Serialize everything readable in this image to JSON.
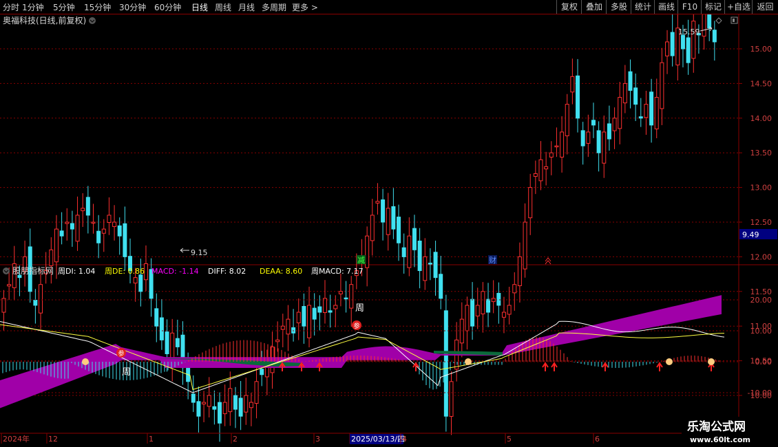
{
  "toolbar": {
    "periods": [
      "分时",
      "1分钟",
      "5分钟",
      "15分钟",
      "30分钟",
      "60分钟",
      "日线",
      "周线",
      "月线",
      "多周期",
      "更多"
    ],
    "active": "日线",
    "more_arrow": ">",
    "actions": [
      "复权",
      "叠加",
      "多股",
      "统计",
      "画线",
      "F10",
      "标记",
      "+自选",
      "返回"
    ]
  },
  "price_panel": {
    "title": "奥福科技(日线,前复权)",
    "y_ticks": [
      "15.00",
      "14.50",
      "14.00",
      "13.50",
      "13.00",
      "12.50",
      "12.00",
      "11.50",
      "11.00",
      "10.50",
      "10.00"
    ],
    "current_price": "9.49",
    "low_marker": "9.15",
    "high_marker": "15.59",
    "markers": [
      {
        "text": "减",
        "color": "#00c000"
      },
      {
        "text": "财",
        "color": "#3060ff"
      }
    ]
  },
  "indicator_panel": {
    "title": "股朋指标网",
    "values": [
      {
        "label": "周DI:",
        "value": "1.04",
        "color": "#ffffff"
      },
      {
        "label": "周DE:",
        "value": "0.86",
        "color": "#ffff00"
      },
      {
        "label": "MACD:",
        "value": "-1.14",
        "color": "#ff00ff"
      },
      {
        "label": "DIFF:",
        "value": "8.02",
        "color": "#ffffff"
      },
      {
        "label": "DEAA:",
        "value": "8.60",
        "color": "#ffff00"
      },
      {
        "label": "周MACD:",
        "value": "7.17",
        "color": "#ffffff"
      }
    ],
    "y_ticks": [
      "20.00",
      "10.00",
      "0.00",
      "-10.00"
    ],
    "week_label": "周",
    "week_label2": "周",
    "badge": "参"
  },
  "date_axis": {
    "labels": [
      "2024年",
      "12",
      "1",
      "2",
      "3",
      "2025/03/13/四",
      "4",
      "5",
      "6"
    ]
  },
  "watermark": {
    "name": "乐淘公式网",
    "url": "www.60lt.com"
  },
  "colors": {
    "up": "#ff3030",
    "down": "#40e0f0",
    "grid": "#8b0000",
    "purple": "#a000a8",
    "green": "#0a6a3a"
  }
}
